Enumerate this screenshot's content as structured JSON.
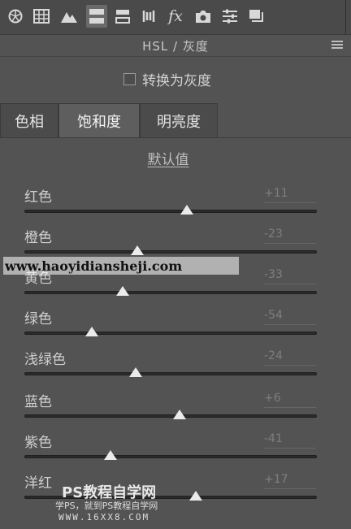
{
  "panel": {
    "title": "HSL / 灰度"
  },
  "toolbar_icons": [
    "aperture-icon",
    "histogram-grid-icon",
    "mountain-icon",
    "hsl-icon",
    "split-toning-icon",
    "detail-icon",
    "fx-icon",
    "camera-icon",
    "sliders-icon",
    "presets-icon"
  ],
  "convert": {
    "label": "转换为灰度",
    "checked": false
  },
  "tabs": [
    {
      "label": "色相",
      "active": false
    },
    {
      "label": "饱和度",
      "active": true
    },
    {
      "label": "明亮度",
      "active": false
    }
  ],
  "default_link": "默认值",
  "sliders": {
    "range": [
      -100,
      100
    ],
    "items": [
      {
        "label": "红色",
        "value": "+11",
        "num": 11
      },
      {
        "label": "橙色",
        "value": "-23",
        "num": -23
      },
      {
        "label": "黄色",
        "value": "-33",
        "num": -33
      },
      {
        "label": "绿色",
        "value": "-54",
        "num": -54
      },
      {
        "label": "浅绿色",
        "value": "-24",
        "num": -24
      },
      {
        "label": "蓝色",
        "value": "+6",
        "num": 6
      },
      {
        "label": "紫色",
        "value": "-41",
        "num": -41
      },
      {
        "label": "洋红",
        "value": "+17",
        "num": 17
      }
    ]
  },
  "watermark": {
    "url": "www.haoyidiansheji.com",
    "brand": "PS教程自学网",
    "sub": "学PS，就到PS教程自学网",
    "site": "WWW.16XX8.COM"
  }
}
